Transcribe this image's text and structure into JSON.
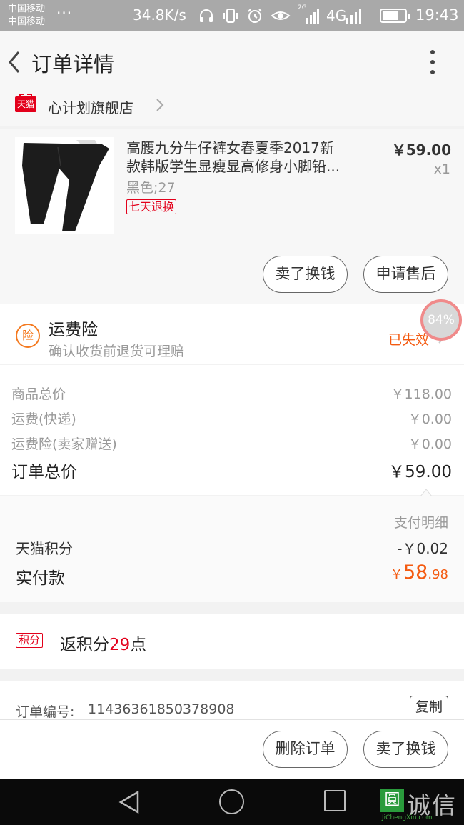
{
  "status_bar": {
    "carrier_1": "中国移动",
    "carrier_2": "中国移动",
    "dots": "···",
    "speed": "34.8K/s",
    "net_2g": "2G",
    "net_4g": "4G",
    "time": "19:43",
    "battery_level": 0.7,
    "icons": [
      "headphones-icon",
      "vibrate-icon",
      "alarm-icon",
      "eye-icon",
      "signal-icon",
      "battery-icon"
    ]
  },
  "header": {
    "title": "订单详情",
    "back_icon": "chevron-left-icon",
    "menu_icon": "more-vertical-icon"
  },
  "shop": {
    "badge": "天猫",
    "name": "心计划旗舰店"
  },
  "product": {
    "name_line_1": "高腰九分牛仔裤女春夏季2017新",
    "name_line_2": "款韩版学生显瘦显高修身小脚铅...",
    "sku": "黑色;27",
    "badge": "七天退换",
    "price": "￥59.00",
    "qty": "x1",
    "buttons": {
      "sell": "卖了换钱",
      "after_sale": "申请售后"
    }
  },
  "insurance": {
    "icon_text": "险",
    "title": "运费险",
    "subtitle": "确认收货前退货可理赔",
    "status": "已失效",
    "floating_badge": "84%"
  },
  "summary": {
    "rows": [
      {
        "label": "商品总价",
        "value": "￥118.00"
      },
      {
        "label": "运费(快递)",
        "value": "￥0.00"
      },
      {
        "label": "运费险(卖家赠送)",
        "value": "￥0.00"
      }
    ],
    "total_label": "订单总价",
    "total_value": "￥59.00"
  },
  "payment": {
    "detail_link": "支付明细",
    "points_label": "天猫积分",
    "points_value": "-￥0.02",
    "paid_label": "实付款",
    "paid_currency": "￥",
    "paid_main": "58",
    "paid_fraction": ".98"
  },
  "points_rebate": {
    "badge": "积分",
    "text_before": "返积分",
    "number": "29",
    "text_after": "点"
  },
  "order": {
    "number_label": "订单编号:",
    "number": "11436361850378908",
    "copy": "复制"
  },
  "bottom_bar": {
    "delete": "删除订单",
    "sell": "卖了换钱"
  },
  "watermark": {
    "logo": "圓",
    "text": "诚信",
    "url": "JiChengXin.com"
  },
  "colors": {
    "accent_red": "#e3001b",
    "accent_orange": "#f45a10",
    "tmall_red": "#e3001b"
  }
}
